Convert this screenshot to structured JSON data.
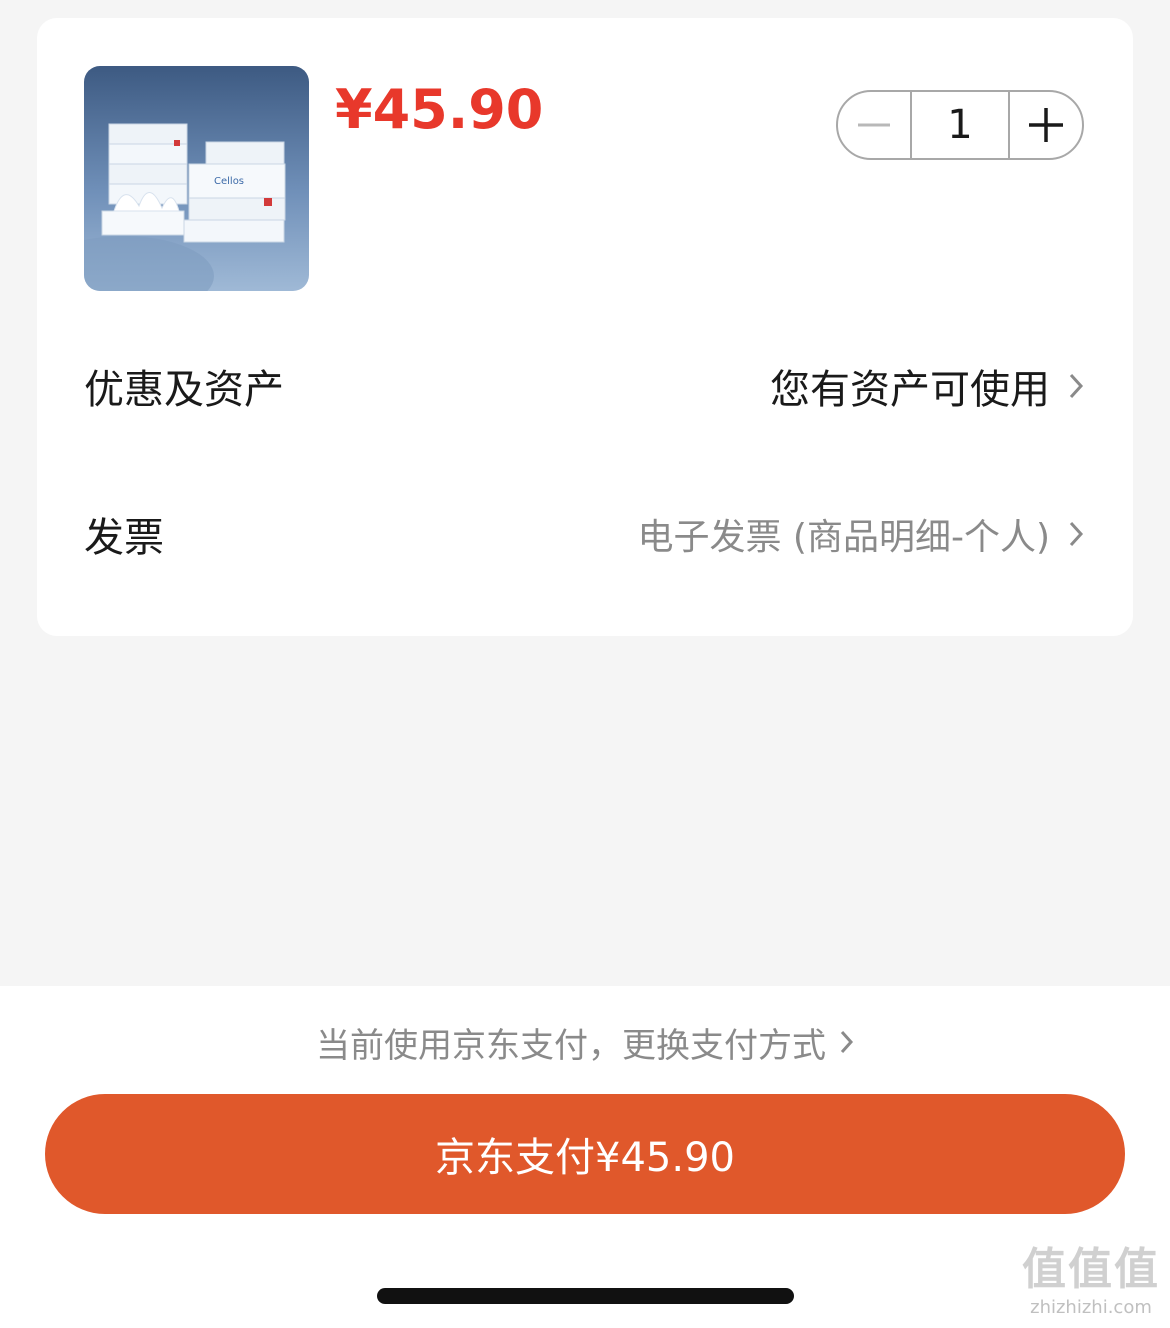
{
  "order": {
    "price": "¥45.90",
    "quantity": "1",
    "product_image_alt": "product-image"
  },
  "rows": {
    "discount_label": "优惠及资产",
    "discount_value": "您有资产可使用",
    "invoice_label": "发票",
    "invoice_value": "电子发票 (商品明细-个人)"
  },
  "footer": {
    "pay_method_text": "当前使用京东支付，更换支付方式",
    "pay_button_label": "京东支付¥45.90"
  },
  "watermark": {
    "mark": "值值值",
    "url": "zhizhizhi.com"
  },
  "colors": {
    "price": "#e8382b",
    "pay_button": "#e0582b",
    "background": "#f5f5f5"
  },
  "icons": [
    "minus-icon",
    "plus-icon",
    "chevron-right-icon"
  ]
}
